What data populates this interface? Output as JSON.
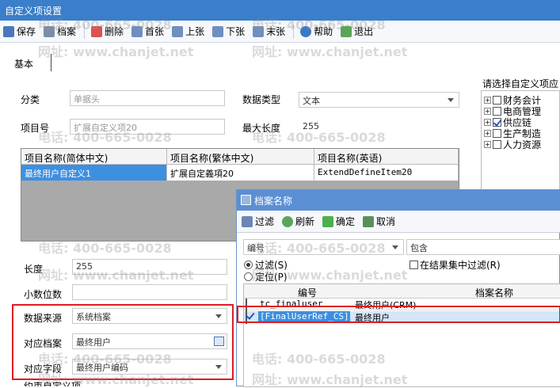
{
  "window": {
    "title": "自定义项设置"
  },
  "toolbar": {
    "save": "保存",
    "archive": "档案",
    "delete": "删除",
    "first": "首张",
    "prev": "上张",
    "next": "下张",
    "last": "末张",
    "help": "帮助",
    "exit": "退出"
  },
  "tabs": {
    "basic": "基本"
  },
  "form": {
    "category_label": "分类",
    "category_value": "单据头",
    "datatype_label": "数据类型",
    "datatype_value": "文本",
    "item_no_label": "项目号",
    "item_no_value": "扩展自定义项20",
    "maxlen_label": "最大长度",
    "maxlen_value": "255",
    "length_label": "长度",
    "length_value": "255",
    "decimals_label": "小数位数",
    "source_label": "数据来源",
    "source_value": "系统档案",
    "archive_label": "对应档案",
    "archive_value": "最终用户",
    "field_label": "对应字段",
    "field_value": "最终用户编码",
    "cut_label": "约束自定义项"
  },
  "grid": {
    "headers": [
      "项目名称(简体中文)",
      "项目名称(繁体中文)",
      "项目名称(英语)"
    ],
    "row": [
      "最终用户自定义1",
      "扩展自定義項20",
      "ExtendDefineItem20"
    ]
  },
  "tree": {
    "title": "请选择自定义项应",
    "items": [
      {
        "label": "财务会计",
        "checked": false
      },
      {
        "label": "电商管理",
        "checked": false
      },
      {
        "label": "供应链",
        "checked": true
      },
      {
        "label": "生产制造",
        "checked": false
      },
      {
        "label": "人力资源",
        "checked": false
      }
    ]
  },
  "watermark": {
    "phone": "电话: 400-665-0028",
    "site": "网址: www.chanjet.net"
  },
  "dialog": {
    "title": "档案名称",
    "filter": "过滤",
    "refresh": "刷新",
    "ok": "确定",
    "cancel": "取消",
    "field_select": "编号",
    "op_select": "包含",
    "radio_filter": "过滤(S)",
    "radio_locate": "定位(P)",
    "filter_in_results": "在结果集中过滤(R)",
    "col_code": "编号",
    "col_name": "档案名称",
    "rows": [
      {
        "code": "tc_finaluser",
        "name": "最终用户(CRM)",
        "checked": false
      },
      {
        "code": "[FinalUserRef_CS]",
        "name": "最终用户",
        "checked": true
      }
    ]
  }
}
